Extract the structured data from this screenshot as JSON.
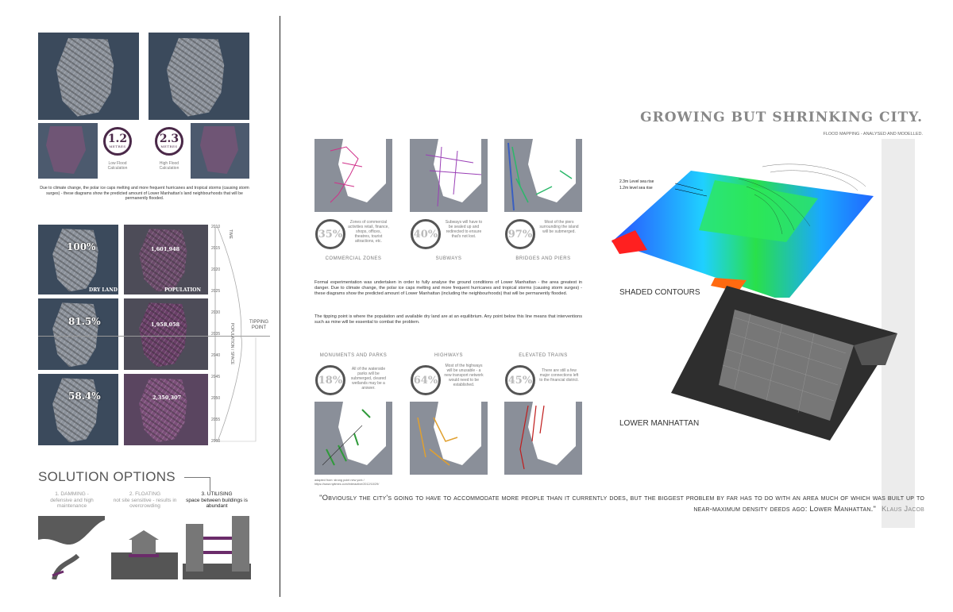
{
  "left_panel": {
    "low_flood": {
      "value": "1.2",
      "unit": "METRES",
      "label_line1": "Low Flood",
      "label_line2": "Calculation"
    },
    "high_flood": {
      "value": "2.3",
      "unit": "METRES",
      "label_line1": "High Flood",
      "label_line2": "Calculation"
    },
    "intro_text": "Due to climate change, the polar ice caps melting and more frequent hurricanes and tropical storms (causing storm surges) - these diagrams show the predicted amount of Lower Manhattan's land neighbourhoods that will be permanently flooded.",
    "rows": [
      {
        "dry_land": "100%",
        "population": "1,601,948"
      },
      {
        "dry_land": "81.5%",
        "population": "1,958,058"
      },
      {
        "dry_land": "58.4%",
        "population": "2,350,307"
      }
    ],
    "dry_land_caption": "DRY LAND",
    "population_caption": "POPULATION",
    "years": [
      "2010",
      "2015",
      "2020",
      "2025",
      "2030",
      "2035",
      "2040",
      "2045",
      "2050",
      "2055",
      "2060"
    ],
    "axis_top": "TIME",
    "axis_mid": "POPULATION / SPACE",
    "tipping_point": "TIPPING POINT",
    "solution_title": "SOLUTION OPTIONS",
    "solutions": [
      {
        "title": "1. DAMMING -",
        "desc": "defensive and high maintenance"
      },
      {
        "title": "2. FLOATING",
        "desc": "not site sensitive - results in overcrowding"
      },
      {
        "title": "3. UTILISING",
        "desc": "space between buildings is abundant"
      }
    ]
  },
  "middle_panel": {
    "top_items": [
      {
        "pct": "35%",
        "desc": "Zones of commercial activities retail, finance, shops, offices, theatres, tourist attractions, etc.",
        "category": "COMMERCIAL ZONES"
      },
      {
        "pct": "40%",
        "desc": "Subways will have to be sealed up and redirected to ensure that's not lost.",
        "category": "SUBWAYS"
      },
      {
        "pct": "97%",
        "desc": "Most of the piers surrounding the island will be submerged.",
        "category": "BRIDGES AND PIERS"
      }
    ],
    "paragraph1": "Formal experimentation was undertaken in order to fully analyse the ground conditions of Lower Manhattan - the area greatest in danger. Due to climate change, the polar ice caps melting and more frequent hurricanes and tropical storms (causing storm surges) - these diagrams show the predicted amount of Lower Manhattan (including the neighbourhoods) that will be permanently flooded.",
    "paragraph2": "The tipping point is where the population and available dry land are at an equilibrium. Any point below this line means that interventions such as mine will be essential to combat the problem.",
    "bottom_items": [
      {
        "category": "MONUMENTS AND PARKS",
        "pct": "18%",
        "desc": "All of the waterside parks will be submerged, cleared wetlands may be a answer."
      },
      {
        "category": "HIGHWAYS",
        "pct": "64%",
        "desc": "Most of the highways will be unusable - a new transport network would need to be established."
      },
      {
        "category": "ELEVATED TRAINS",
        "pct": "45%",
        "desc": "There are still a few major connections left to the financial district."
      }
    ],
    "source_note": "adapted from: strong point new york / https://www.nytimes.com/interactive/2012/10/29/"
  },
  "right_panel": {
    "title": "GROWING BUT SHRINKING CITY.",
    "subtitle": "FLOOD MAPPING - ANALYSED AND MODELLED.",
    "legend_1": "2.3m Level sea rise",
    "legend_2": "1.2m level sea rise",
    "shaded_label": "SHADED CONTOURS",
    "manhattan_label": "LOWER MANHATTAN",
    "quote": "\"Obviously the city's going to have to accommodate more people than it currently does, but the biggest problem by far has to do with an area much of which was built up to near-maximum density deeds ago: Lower Manhattan.\"",
    "quote_author": "Klaus Jacob"
  },
  "colors": {
    "accent_purple": "#4a2848",
    "dark_grey": "#555555",
    "map_water": "#3b4a5c"
  }
}
